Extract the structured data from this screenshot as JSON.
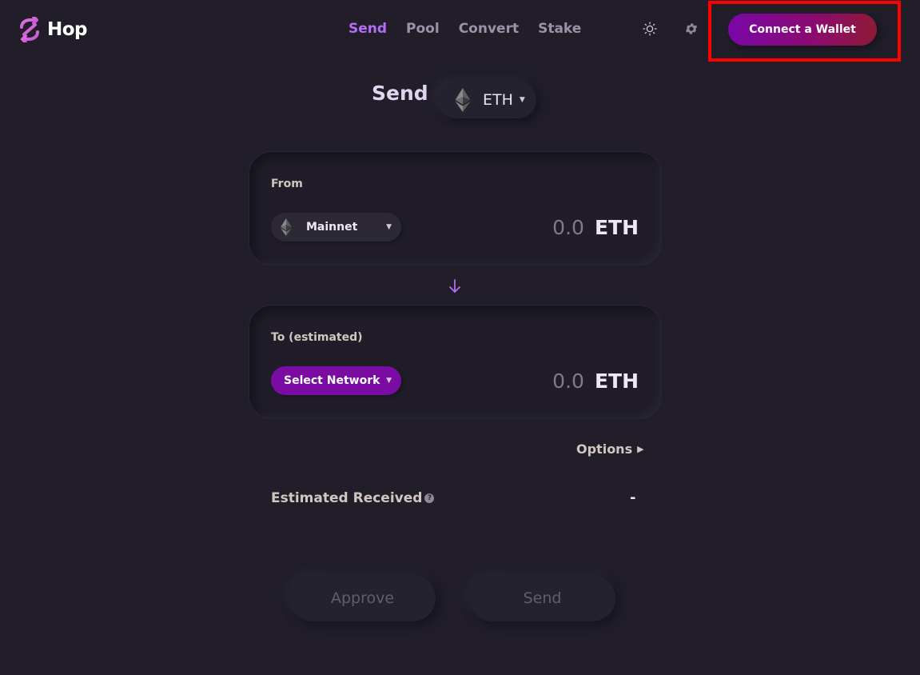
{
  "header": {
    "logo_text": "Hop",
    "nav": [
      {
        "label": "Send",
        "active": true
      },
      {
        "label": "Pool",
        "active": false
      },
      {
        "label": "Convert",
        "active": false
      },
      {
        "label": "Stake",
        "active": false
      }
    ],
    "theme_icon": "sun-icon",
    "settings_icon": "gear-icon",
    "connect_wallet_label": "Connect a Wallet"
  },
  "title": {
    "text": "Send",
    "token_symbol": "ETH",
    "token_icon": "ethereum-icon"
  },
  "from_card": {
    "label": "From",
    "network": "Mainnet",
    "amount": "0.0",
    "unit": "ETH"
  },
  "to_card": {
    "label": "To (estimated)",
    "network": "Select Network",
    "amount": "0.0",
    "unit": "ETH"
  },
  "options_label": "Options",
  "estimated_received": {
    "label": "Estimated Received",
    "value": "-"
  },
  "buttons": {
    "approve": "Approve",
    "send": "Send"
  },
  "colors": {
    "background": "#211e2a",
    "accent": "#b36df6",
    "wallet_gradient_start": "#7a06a8",
    "wallet_gradient_end": "#8e1a36",
    "highlight_box": "#ff0000"
  }
}
